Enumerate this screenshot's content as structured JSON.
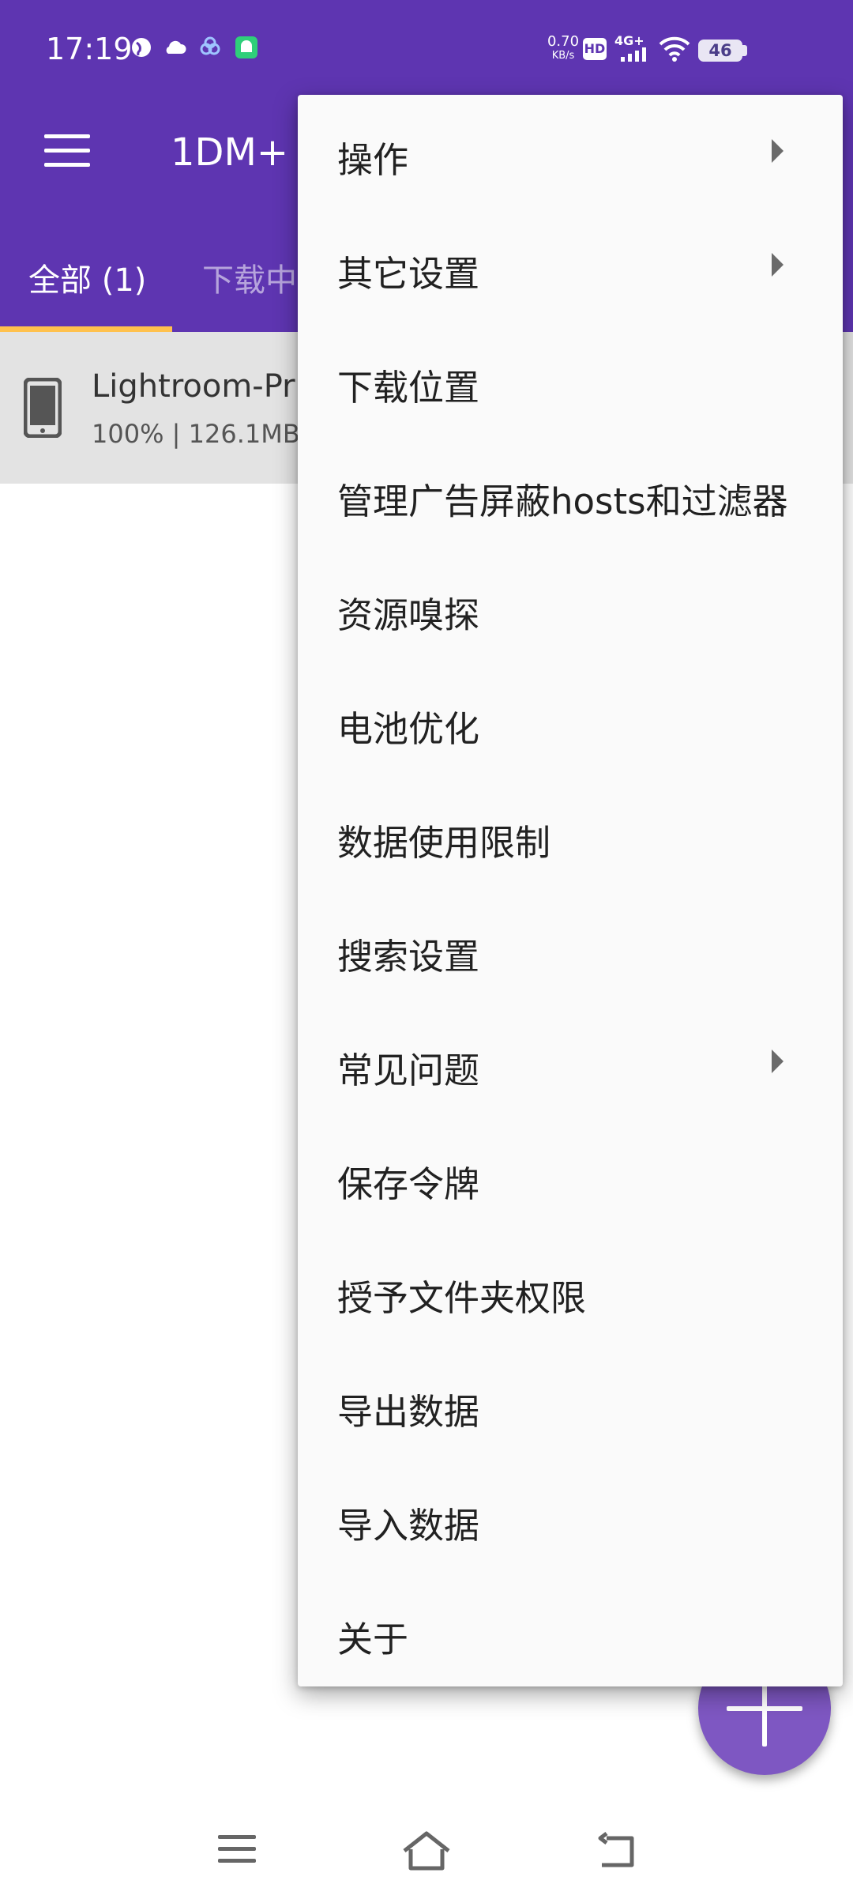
{
  "status_bar": {
    "time": "17:19",
    "net_speed": "0.70",
    "net_unit": "KB/s",
    "hd_label": "HD",
    "network_type": "4G+",
    "battery": "46"
  },
  "app_bar": {
    "title": "1DM+",
    "tabs": [
      "全部 (1)",
      "下载中"
    ],
    "accent_color": "#5e35b1",
    "indicator_color": "#ffc14d"
  },
  "download_item": {
    "name": "Lightroom-Pr",
    "meta": "100% | 126.1MB"
  },
  "menu": {
    "items": [
      {
        "label": "操作",
        "has_submenu": true
      },
      {
        "label": "其它设置",
        "has_submenu": true
      },
      {
        "label": "下载位置",
        "has_submenu": false
      },
      {
        "label": "管理广告屏蔽hosts和过滤器",
        "has_submenu": false
      },
      {
        "label": "资源嗅探",
        "has_submenu": false
      },
      {
        "label": "电池优化",
        "has_submenu": false
      },
      {
        "label": "数据使用限制",
        "has_submenu": false
      },
      {
        "label": "搜索设置",
        "has_submenu": false
      },
      {
        "label": "常见问题",
        "has_submenu": true
      },
      {
        "label": "保存令牌",
        "has_submenu": false
      },
      {
        "label": "授予文件夹权限",
        "has_submenu": false
      },
      {
        "label": "导出数据",
        "has_submenu": false
      },
      {
        "label": "导入数据",
        "has_submenu": false
      },
      {
        "label": "关于",
        "has_submenu": false
      }
    ]
  },
  "icons": {
    "menu": "hamburger-icon",
    "file": "phone-file-icon",
    "fab": "plus-icon",
    "nav_recent": "recent-apps-icon",
    "nav_home": "home-icon",
    "nav_back": "back-icon"
  }
}
